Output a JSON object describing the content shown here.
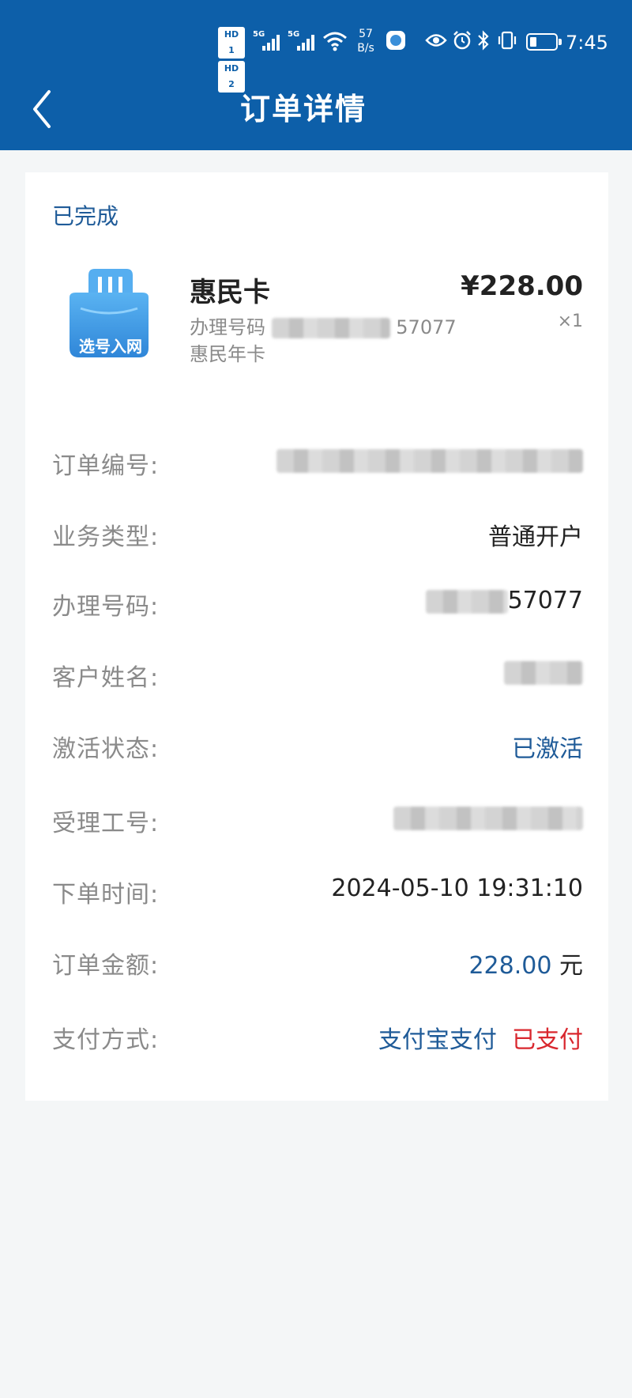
{
  "status_bar": {
    "hd1": "HD 1",
    "hd2": "HD 2",
    "net1": "5G",
    "net2": "5G",
    "speed_value": "57",
    "speed_unit": "B/s",
    "time": "7:45",
    "battery_level": 0.2
  },
  "header": {
    "title": "订单详情",
    "back_icon": "chevron-left-icon"
  },
  "order": {
    "status": "已完成",
    "product": {
      "name": "惠民卡",
      "icon_label": "选号入网",
      "number_label": "办理号码",
      "number_suffix": "57077",
      "plan": "惠民年卡",
      "price": "¥228.00",
      "quantity": "×1"
    },
    "details": {
      "order_no_label": "订单编号:",
      "business_type_label": "业务类型:",
      "business_type": "普通开户",
      "phone_label": "办理号码:",
      "phone_suffix": "57077",
      "customer_label": "客户姓名:",
      "activation_label": "激活状态:",
      "activation": "已激活",
      "staff_label": "受理工号:",
      "time_label": "下单时间:",
      "time": "2024-05-10 19:31:10",
      "amount_label": "订单金额:",
      "amount": "228.00",
      "amount_unit": "元",
      "payment_label": "支付方式:",
      "payment_method": "支付宝支付",
      "payment_status": "已支付"
    }
  },
  "colors": {
    "header_bg": "#0d5fa9",
    "accent_blue": "#1f5b98",
    "paid_red": "#d9272e"
  }
}
